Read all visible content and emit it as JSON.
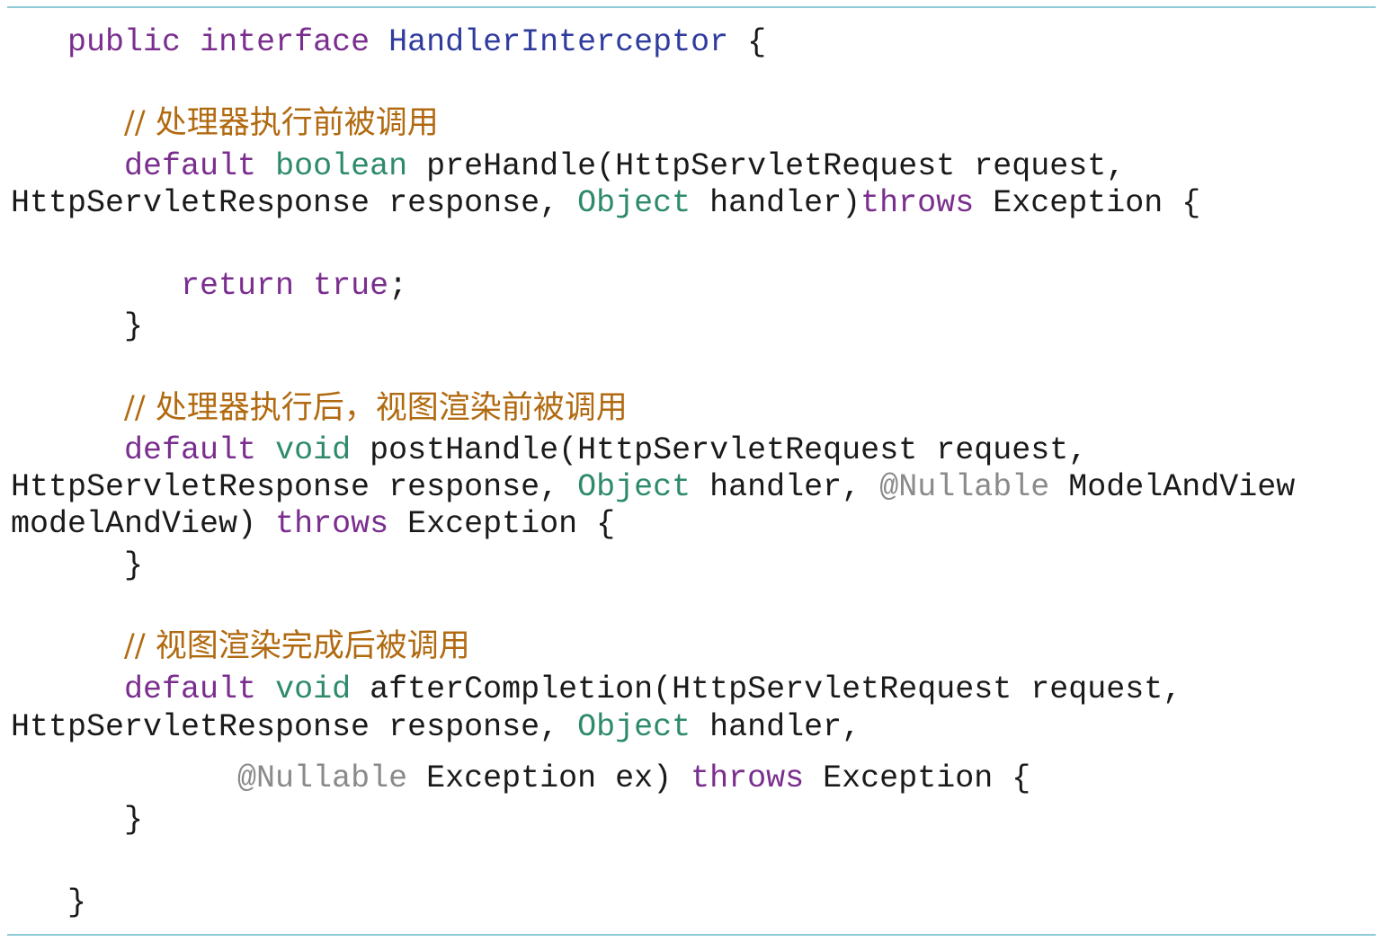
{
  "code": {
    "line_01": [
      {
        "t": "   ",
        "c": "pl"
      },
      {
        "t": "public",
        "c": "kw"
      },
      {
        "t": " ",
        "c": "pl"
      },
      {
        "t": "interface",
        "c": "kw"
      },
      {
        "t": " ",
        "c": "pl"
      },
      {
        "t": "HandlerInterceptor",
        "c": "cls"
      },
      {
        "t": " {",
        "c": "pl"
      }
    ],
    "line_02": [
      {
        "t": "      ",
        "c": "pl"
      },
      {
        "t": "// 处理器执行前被调用",
        "c": "cm"
      }
    ],
    "line_03": [
      {
        "t": "      ",
        "c": "pl"
      },
      {
        "t": "default",
        "c": "kw"
      },
      {
        "t": " ",
        "c": "pl"
      },
      {
        "t": "boolean",
        "c": "ty"
      },
      {
        "t": " preHandle(HttpServletRequest request,",
        "c": "pl"
      }
    ],
    "line_04": [
      {
        "t": "HttpServletResponse response, ",
        "c": "pl"
      },
      {
        "t": "Object",
        "c": "ty"
      },
      {
        "t": " handler)",
        "c": "pl"
      },
      {
        "t": "throws",
        "c": "kw"
      },
      {
        "t": " Exception {",
        "c": "pl"
      }
    ],
    "line_05": [
      {
        "t": "         ",
        "c": "pl"
      },
      {
        "t": "return",
        "c": "kw"
      },
      {
        "t": " ",
        "c": "pl"
      },
      {
        "t": "true",
        "c": "kw"
      },
      {
        "t": ";",
        "c": "pl"
      }
    ],
    "line_06": [
      {
        "t": "      }",
        "c": "pl"
      }
    ],
    "line_07": [
      {
        "t": "      ",
        "c": "pl"
      },
      {
        "t": "// 处理器执行后，视图渲染前被调用",
        "c": "cm"
      }
    ],
    "line_08": [
      {
        "t": "      ",
        "c": "pl"
      },
      {
        "t": "default",
        "c": "kw"
      },
      {
        "t": " ",
        "c": "pl"
      },
      {
        "t": "void",
        "c": "ty"
      },
      {
        "t": " postHandle(HttpServletRequest request,",
        "c": "pl"
      }
    ],
    "line_09": [
      {
        "t": "HttpServletResponse response, ",
        "c": "pl"
      },
      {
        "t": "Object",
        "c": "ty"
      },
      {
        "t": " handler, ",
        "c": "pl"
      },
      {
        "t": "@Nullable",
        "c": "an"
      },
      {
        "t": " ModelAndView",
        "c": "pl"
      }
    ],
    "line_10": [
      {
        "t": "modelAndView) ",
        "c": "pl"
      },
      {
        "t": "throws",
        "c": "kw"
      },
      {
        "t": " Exception {",
        "c": "pl"
      }
    ],
    "line_11": [
      {
        "t": "      }",
        "c": "pl"
      }
    ],
    "line_12": [
      {
        "t": "      ",
        "c": "pl"
      },
      {
        "t": "// 视图渲染完成后被调用",
        "c": "cm"
      }
    ],
    "line_13": [
      {
        "t": "      ",
        "c": "pl"
      },
      {
        "t": "default",
        "c": "kw"
      },
      {
        "t": " ",
        "c": "pl"
      },
      {
        "t": "void",
        "c": "ty"
      },
      {
        "t": " afterCompletion(HttpServletRequest request,",
        "c": "pl"
      }
    ],
    "line_14": [
      {
        "t": "HttpServletResponse response, ",
        "c": "pl"
      },
      {
        "t": "Object",
        "c": "ty"
      },
      {
        "t": " handler,",
        "c": "pl"
      }
    ],
    "line_15": [
      {
        "t": "            ",
        "c": "pl"
      },
      {
        "t": "@Nullable",
        "c": "an"
      },
      {
        "t": " Exception ex) ",
        "c": "pl"
      },
      {
        "t": "throws",
        "c": "kw"
      },
      {
        "t": " Exception {",
        "c": "pl"
      }
    ],
    "line_16": [
      {
        "t": "      }",
        "c": "pl"
      }
    ],
    "line_17": [
      {
        "t": "   }",
        "c": "pl"
      }
    ]
  }
}
